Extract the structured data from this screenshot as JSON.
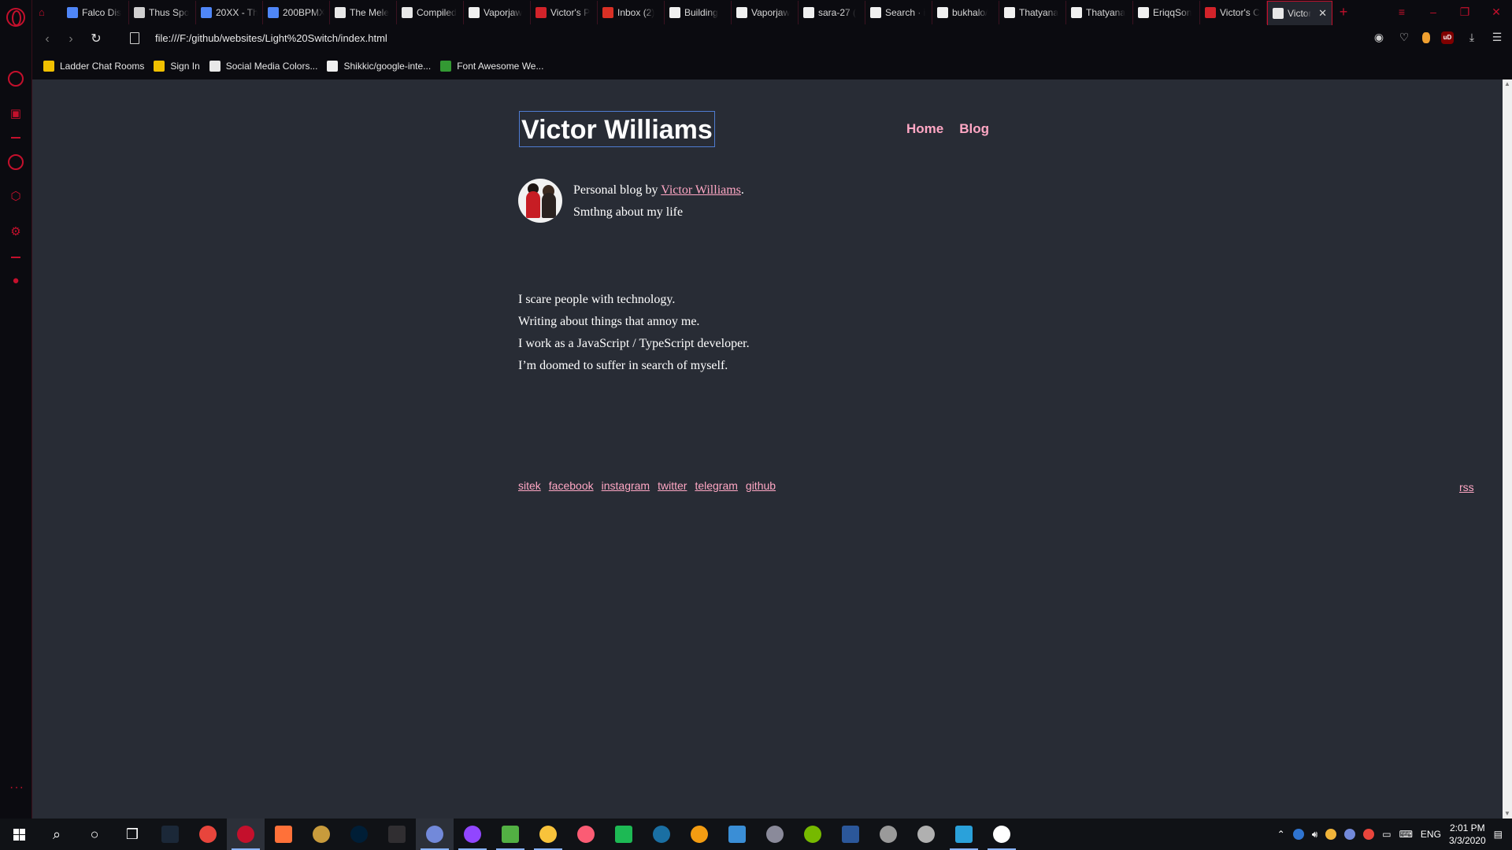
{
  "browser": {
    "tabs": [
      {
        "title": "Falco Dis",
        "favicon_color": "#4f86f7"
      },
      {
        "title": "Thus Spo",
        "favicon_color": "#d0d0d0"
      },
      {
        "title": "20XX - Th",
        "favicon_color": "#4f86f7"
      },
      {
        "title": "200BPMX",
        "favicon_color": "#4f86f7"
      },
      {
        "title": "The Mele",
        "favicon_color": "#e8e8e8"
      },
      {
        "title": "Compiled",
        "favicon_color": "#e8e8e8"
      },
      {
        "title": "Vaporjaw",
        "favicon_color": "#f0f0f0"
      },
      {
        "title": "Victor's P",
        "favicon_color": "#d2232a"
      },
      {
        "title": "Inbox (2)",
        "favicon_color": "#d93025"
      },
      {
        "title": "Building",
        "favicon_color": "#f0f0f0"
      },
      {
        "title": "Vaporjaw",
        "favicon_color": "#f0f0f0"
      },
      {
        "title": "sara-27 (",
        "favicon_color": "#f0f0f0"
      },
      {
        "title": "Search · i",
        "favicon_color": "#f0f0f0"
      },
      {
        "title": "bukhalo/",
        "favicon_color": "#f0f0f0"
      },
      {
        "title": "Thatyana",
        "favicon_color": "#f0f0f0"
      },
      {
        "title": "Thatyana",
        "favicon_color": "#f0f0f0"
      },
      {
        "title": "EriqqSon",
        "favicon_color": "#f0f0f0"
      },
      {
        "title": "Victor's C",
        "favicon_color": "#d2232a"
      },
      {
        "title": "Victor",
        "favicon_color": "#e8e8e8",
        "active": true
      }
    ],
    "url": "file:///F:/github/websites/Light%20Switch/index.html",
    "bookmarks": [
      {
        "label": "Ladder Chat Rooms",
        "icon_color": "#f0c000"
      },
      {
        "label": "Sign In",
        "icon_color": "#f0c000"
      },
      {
        "label": "Social Media Colors...",
        "icon_color": "#e8e8e8"
      },
      {
        "label": "Shikkic/google-inte...",
        "icon_color": "#f0f0f0"
      },
      {
        "label": "Font Awesome We...",
        "icon_color": "#339933"
      }
    ]
  },
  "blog": {
    "title": "Victor Williams",
    "nav": {
      "home": "Home",
      "blog": "Blog"
    },
    "bio_prefix": "Personal blog by ",
    "bio_author": "Victor Williams",
    "bio_suffix": ".",
    "bio_tagline": "Smthng about my life",
    "about_lines": [
      "I scare people with technology.",
      "Writing about things that annoy me.",
      "I work as a JavaScript / TypeScript developer.",
      "I’m doomed to suffer in search of myself."
    ],
    "footer_links": [
      "sitek",
      "facebook",
      "instagram",
      "twitter",
      "telegram",
      "github"
    ],
    "rss": "rss"
  },
  "taskbar": {
    "apps": [
      {
        "name": "search-icon",
        "color": "#ffffff"
      },
      {
        "name": "cortana-icon",
        "color": "#ffffff"
      },
      {
        "name": "task-view-icon",
        "color": "#ffffff"
      },
      {
        "name": "steam-icon",
        "color": "#1b2838"
      },
      {
        "name": "chrome-icon",
        "color": "#e8453c"
      },
      {
        "name": "opera-gx-icon",
        "color": "#c4102c",
        "active": true
      },
      {
        "name": "firefox-icon",
        "color": "#ff7139"
      },
      {
        "name": "league-icon",
        "color": "#c89b3c"
      },
      {
        "name": "photoshop-icon",
        "color": "#001e36"
      },
      {
        "name": "obs-icon",
        "color": "#302e31"
      },
      {
        "name": "discord-icon",
        "color": "#7289da",
        "active": true
      },
      {
        "name": "twitch-icon",
        "color": "#9146ff",
        "run": true
      },
      {
        "name": "xbox-icon",
        "color": "#52b043",
        "run": true
      },
      {
        "name": "file-explorer-icon",
        "color": "#f8c33b",
        "run": true
      },
      {
        "name": "itunes-icon",
        "color": "#fb5c74"
      },
      {
        "name": "spotify-icon",
        "color": "#1db954"
      },
      {
        "name": "musescore-icon",
        "color": "#1a6fa3"
      },
      {
        "name": "fl-studio-icon",
        "color": "#f39c12"
      },
      {
        "name": "dolphin-icon",
        "color": "#3a8ed6"
      },
      {
        "name": "game-icon",
        "color": "#8a8a9a"
      },
      {
        "name": "nvidia-icon",
        "color": "#76b900"
      },
      {
        "name": "word-icon",
        "color": "#2b579a"
      },
      {
        "name": "tool-icon",
        "color": "#9a9a9a"
      },
      {
        "name": "app-icon",
        "color": "#b0b0b0"
      },
      {
        "name": "telegram-icon",
        "color": "#2aa1da",
        "run": true
      },
      {
        "name": "settings-icon",
        "color": "#ffffff",
        "run": true
      }
    ],
    "tray": {
      "lang": "ENG",
      "time": "2:01 PM",
      "date": "3/3/2020"
    }
  }
}
